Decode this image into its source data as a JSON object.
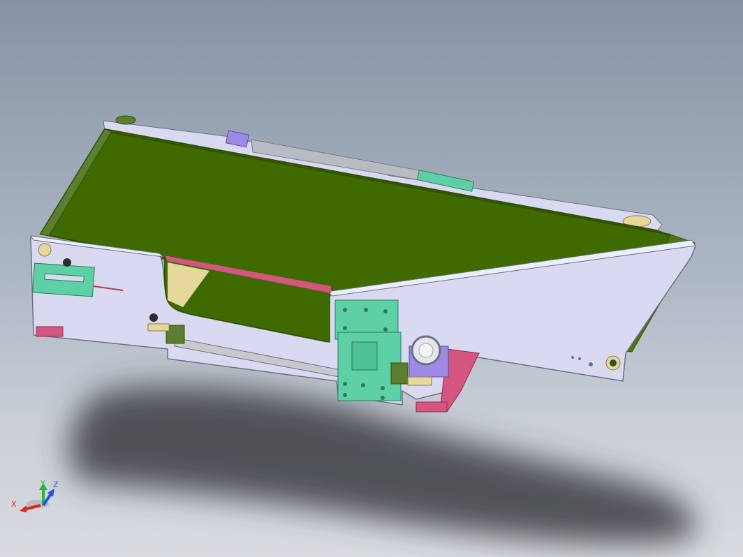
{
  "viewport": {
    "background_top": "#8794a6",
    "background_bottom": "#d8dbe0"
  },
  "model": {
    "colors": {
      "belt": "#3f6a00",
      "belt_edge": "#2e4f00",
      "frame": "#d9daf2",
      "frame_edge": "#6b6f86",
      "bracket": "#5ed0a6",
      "accent_pink": "#d4557f",
      "accent_purple": "#9e8ae6",
      "roller_tan": "#e6d89c",
      "shadow": "#3a3d43"
    }
  },
  "triad": {
    "x_label": "X",
    "y_label": "Y",
    "z_label": "Z",
    "x_color": "#e2231a",
    "y_color": "#2bb23b",
    "z_color": "#2a4fe0"
  }
}
